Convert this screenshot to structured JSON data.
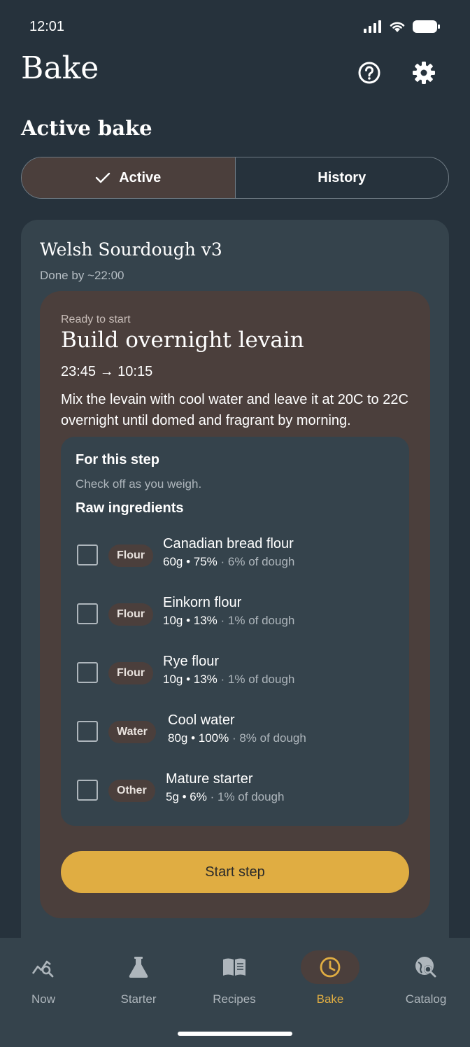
{
  "status_bar": {
    "time": "12:01"
  },
  "header": {
    "title": "Bake",
    "help_icon": "help-circle-icon",
    "settings_icon": "gear-icon"
  },
  "section": {
    "title": "Active bake"
  },
  "segmented": {
    "options": [
      {
        "label": "Active",
        "selected": true
      },
      {
        "label": "History",
        "selected": false
      }
    ]
  },
  "bake": {
    "recipe_name": "Welsh Sourdough v3",
    "done_by": "Done by ~22:00",
    "step": {
      "status": "Ready to start",
      "title": "Build overnight levain",
      "time_range": "23:45 → 10:15",
      "description": "Mix the levain with cool water and leave it at 20C to 22C overnight until domed and fragrant by morning.",
      "ingredients_box": {
        "title": "For this step",
        "hint": "Check off as you weigh.",
        "subtitle": "Raw ingredients",
        "items": [
          {
            "category": "Flour",
            "name": "Canadian bread flour",
            "amount": "60g • 75%",
            "share": " · 6% of dough",
            "checked": false
          },
          {
            "category": "Flour",
            "name": "Einkorn flour",
            "amount": "10g • 13%",
            "share": " · 1% of dough",
            "checked": false
          },
          {
            "category": "Flour",
            "name": "Rye flour",
            "amount": "10g • 13%",
            "share": " · 1% of dough",
            "checked": false
          },
          {
            "category": "Water",
            "name": "Cool water",
            "amount": "80g • 100%",
            "share": " · 8% of dough",
            "checked": false
          },
          {
            "category": "Other",
            "name": "Mature starter",
            "amount": "5g • 6%",
            "share": " · 1% of dough",
            "checked": false
          }
        ]
      },
      "start_button": "Start step"
    }
  },
  "bottom_nav": {
    "items": [
      {
        "label": "Now",
        "icon": "chart-search-icon",
        "active": false
      },
      {
        "label": "Starter",
        "icon": "flask-icon",
        "active": false
      },
      {
        "label": "Recipes",
        "icon": "book-icon",
        "active": false
      },
      {
        "label": "Bake",
        "icon": "clock-icon",
        "active": true
      },
      {
        "label": "Catalog",
        "icon": "globe-search-icon",
        "active": false
      }
    ]
  },
  "colors": {
    "background": "#26323c",
    "card": "#35434c",
    "accent_surface": "#4b3f3c",
    "accent": "#e0ad42"
  }
}
